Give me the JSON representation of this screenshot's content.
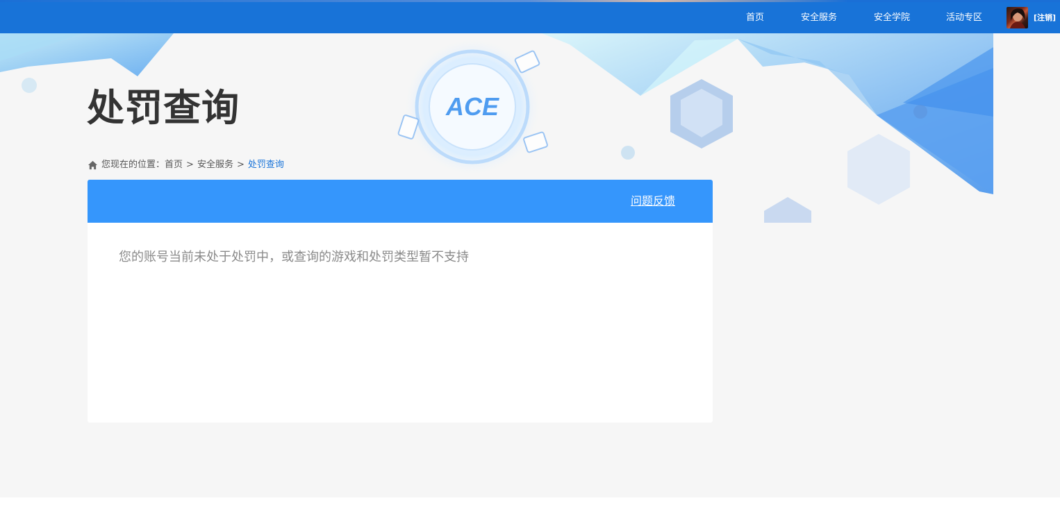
{
  "nav": {
    "items": [
      {
        "label": "首页"
      },
      {
        "label": "安全服务"
      },
      {
        "label": "安全学院"
      },
      {
        "label": "活动专区"
      }
    ],
    "logout_label": "[注销]"
  },
  "page": {
    "title": "处罚查询"
  },
  "breadcrumb": {
    "prefix": "您现在的位置：",
    "home": "首页",
    "separator": ">",
    "section": "安全服务",
    "current": "处罚查询"
  },
  "card": {
    "feedback_label": "问题反馈",
    "result_text": "您的账号当前未处于处罚中，或查询的游戏和处罚类型暂不支持"
  },
  "colors": {
    "nav_bg": "#1873d8",
    "card_header_bg": "#3596fc",
    "title_text": "#333333",
    "breadcrumb_current": "#1873d8",
    "result_text": "#8a8a8a"
  },
  "icons": {
    "home": "home-icon",
    "avatar": "user-avatar",
    "banner_logo": "ace-logo"
  }
}
